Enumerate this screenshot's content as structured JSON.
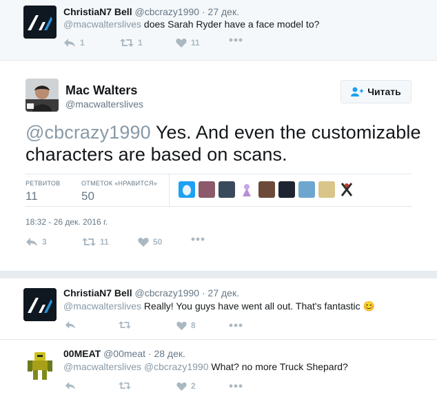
{
  "parent_tweet": {
    "name": "ChristiaN7 Bell",
    "handle": "@cbcrazy1990",
    "dot": "·",
    "date": "27 дек.",
    "mention": "@macwalterslives",
    "text": " does Sarah Ryder have a face model to?",
    "reply_count": "1",
    "retweet_count": "1",
    "like_count": "11"
  },
  "main_tweet": {
    "name": "Mac Walters",
    "handle": "@macwalterslives",
    "follow_label": "Читать",
    "mention": "@cbcrazy1990",
    "text": " Yes. And even the customizable characters are based on scans.",
    "retweets_label": "РЕТВИТОВ",
    "retweets_value": "11",
    "likes_label": "ОТМЕТОК «НРАВИТСЯ»",
    "likes_value": "50",
    "timestamp": "18:32 - 26 дек. 2016 г.",
    "reply_count": "3",
    "retweet_count": "11",
    "like_count": "50"
  },
  "replies": [
    {
      "name": "ChristiaN7 Bell",
      "handle": "@cbcrazy1990",
      "dot": "·",
      "date": "27 дек.",
      "mention": "@macwalterslives",
      "text": " Really! You guys have went all out. That's fantastic ",
      "emoji": "😊",
      "like_count": "8"
    },
    {
      "name": "00MEAT",
      "handle": "@00meat",
      "dot": "·",
      "date": "28 дек.",
      "mention": "@macwalterslives @cbcrazy1990",
      "text": " What? no more Truck Shepard?",
      "like_count": "2"
    }
  ],
  "colors": {
    "accent": "#1da1f2",
    "icon_gray": "#aab8c2",
    "muted": "#657786",
    "mention": "#8899a6"
  }
}
